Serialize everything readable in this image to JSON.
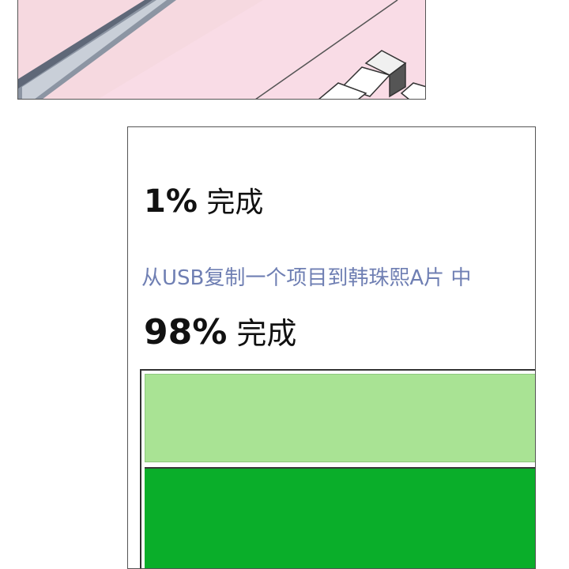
{
  "progress1": {
    "percent": "1%",
    "label": "完成"
  },
  "status": {
    "text": "从USB复制一个项目到韩珠熙A片 中"
  },
  "progress2": {
    "percent": "98%",
    "label": "完成"
  },
  "bars": {
    "light": {
      "fraction": 1.0,
      "color": "#a9e394"
    },
    "dark": {
      "fraction": 1.0,
      "color": "#0aae2a"
    }
  },
  "colors": {
    "status_text": "#6f7fb3",
    "panel_pink": "#f3d3db"
  }
}
